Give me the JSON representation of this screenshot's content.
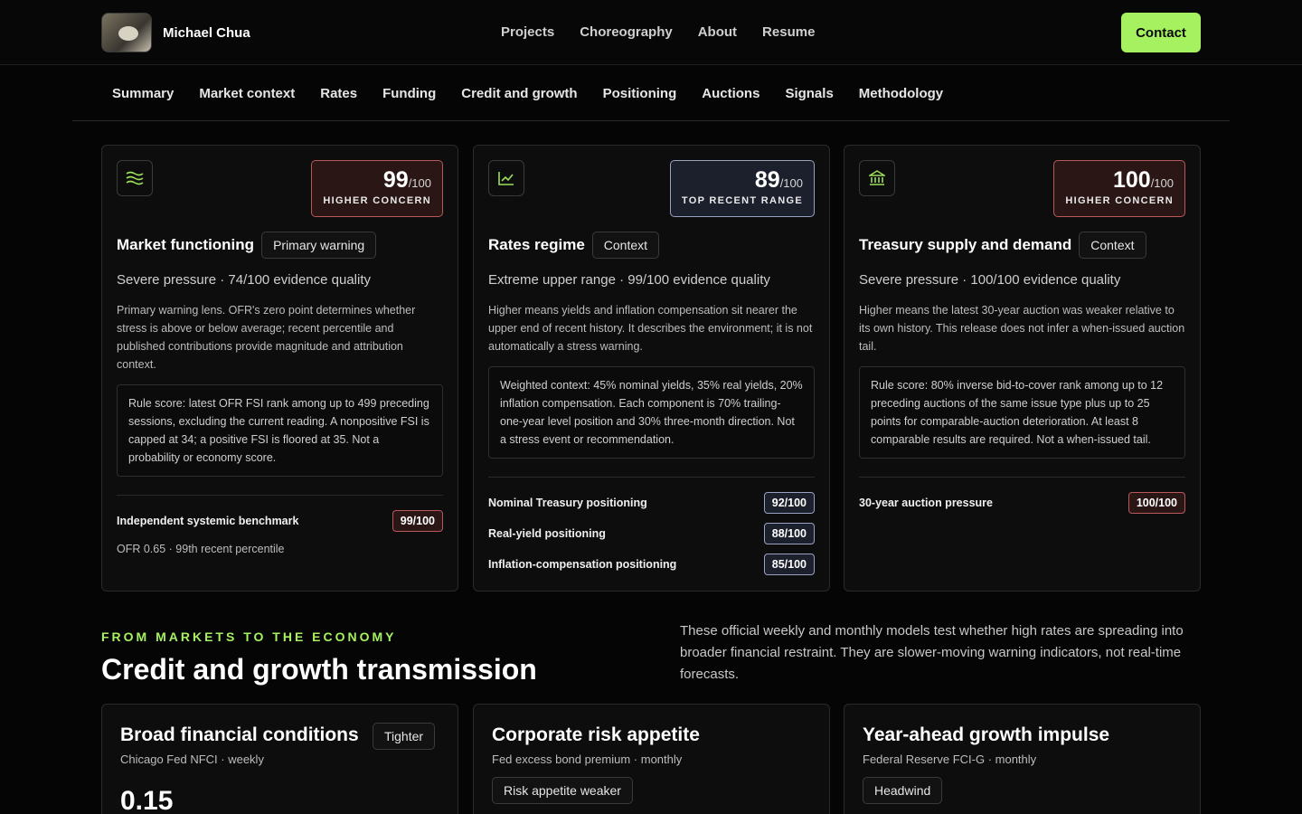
{
  "brand": {
    "name": "Michael Chua"
  },
  "nav": {
    "links": [
      "Projects",
      "Choreography",
      "About",
      "Resume"
    ],
    "contact": "Contact"
  },
  "subnav": [
    "Summary",
    "Market context",
    "Rates",
    "Funding",
    "Credit and growth",
    "Positioning",
    "Auctions",
    "Signals",
    "Methodology"
  ],
  "cards": [
    {
      "icon": "waves-icon",
      "score": "99",
      "den": "/100",
      "score_label": "HIGHER CONCERN",
      "title": "Market functioning",
      "pill": "Primary warning",
      "subtitle": "Severe pressure · 74/100 evidence quality",
      "desc": "Primary warning lens. OFR's zero point determines whether stress is above or below average; recent percentile and published contributions provide magnitude and attribution context.",
      "rule": "Rule score: latest OFR FSI rank among up to 499 preceding sessions, excluding the current reading. A nonpositive FSI is capped at 34; a positive FSI is floored at 35. Not a probability or economy score.",
      "metrics": [
        {
          "label": "Independent systemic benchmark",
          "value": "99/100"
        }
      ],
      "note": "OFR 0.65 · 99th recent percentile"
    },
    {
      "icon": "line-chart-icon",
      "score": "89",
      "den": "/100",
      "score_label": "TOP RECENT RANGE",
      "title": "Rates regime",
      "pill": "Context",
      "subtitle": "Extreme upper range · 99/100 evidence quality",
      "desc": "Higher means yields and inflation compensation sit nearer the upper end of recent history. It describes the environment; it is not automatically a stress warning.",
      "rule": "Weighted context: 45% nominal yields, 35% real yields, 20% inflation compensation. Each component is 70% trailing-one-year level position and 30% three-month direction. Not a stress event or recommendation.",
      "metrics": [
        {
          "label": "Nominal Treasury positioning",
          "value": "92/100"
        },
        {
          "label": "Real-yield positioning",
          "value": "88/100"
        },
        {
          "label": "Inflation-compensation positioning",
          "value": "85/100"
        }
      ]
    },
    {
      "icon": "bank-icon",
      "score": "100",
      "den": "/100",
      "score_label": "HIGHER CONCERN",
      "title": "Treasury supply and demand",
      "pill": "Context",
      "subtitle": "Severe pressure · 100/100 evidence quality",
      "desc": "Higher means the latest 30-year auction was weaker relative to its own history. This release does not infer a when-issued auction tail.",
      "rule": "Rule score: 80% inverse bid-to-cover rank among up to 12 preceding auctions of the same issue type plus up to 25 points for comparable-auction deterioration. At least 8 comparable results are required. Not a when-issued tail.",
      "metrics": [
        {
          "label": "30-year auction pressure",
          "value": "100/100"
        }
      ]
    }
  ],
  "section": {
    "eyebrow": "FROM MARKETS TO THE ECONOMY",
    "title": "Credit and growth transmission",
    "desc": "These official weekly and monthly models test whether high rates are spreading into broader financial restraint. They are slower-moving warning indicators, not real-time forecasts."
  },
  "cards2": [
    {
      "title": "Broad financial conditions",
      "sub": "Chicago Fed NFCI · weekly",
      "pill": "Tighter",
      "value": "0.15"
    },
    {
      "title": "Corporate risk appetite",
      "sub": "Fed excess bond premium · monthly",
      "pill": "Risk appetite weaker"
    },
    {
      "title": "Year-ahead growth impulse",
      "sub": "Federal Reserve FCI-G · monthly",
      "pill": "Headwind"
    }
  ]
}
